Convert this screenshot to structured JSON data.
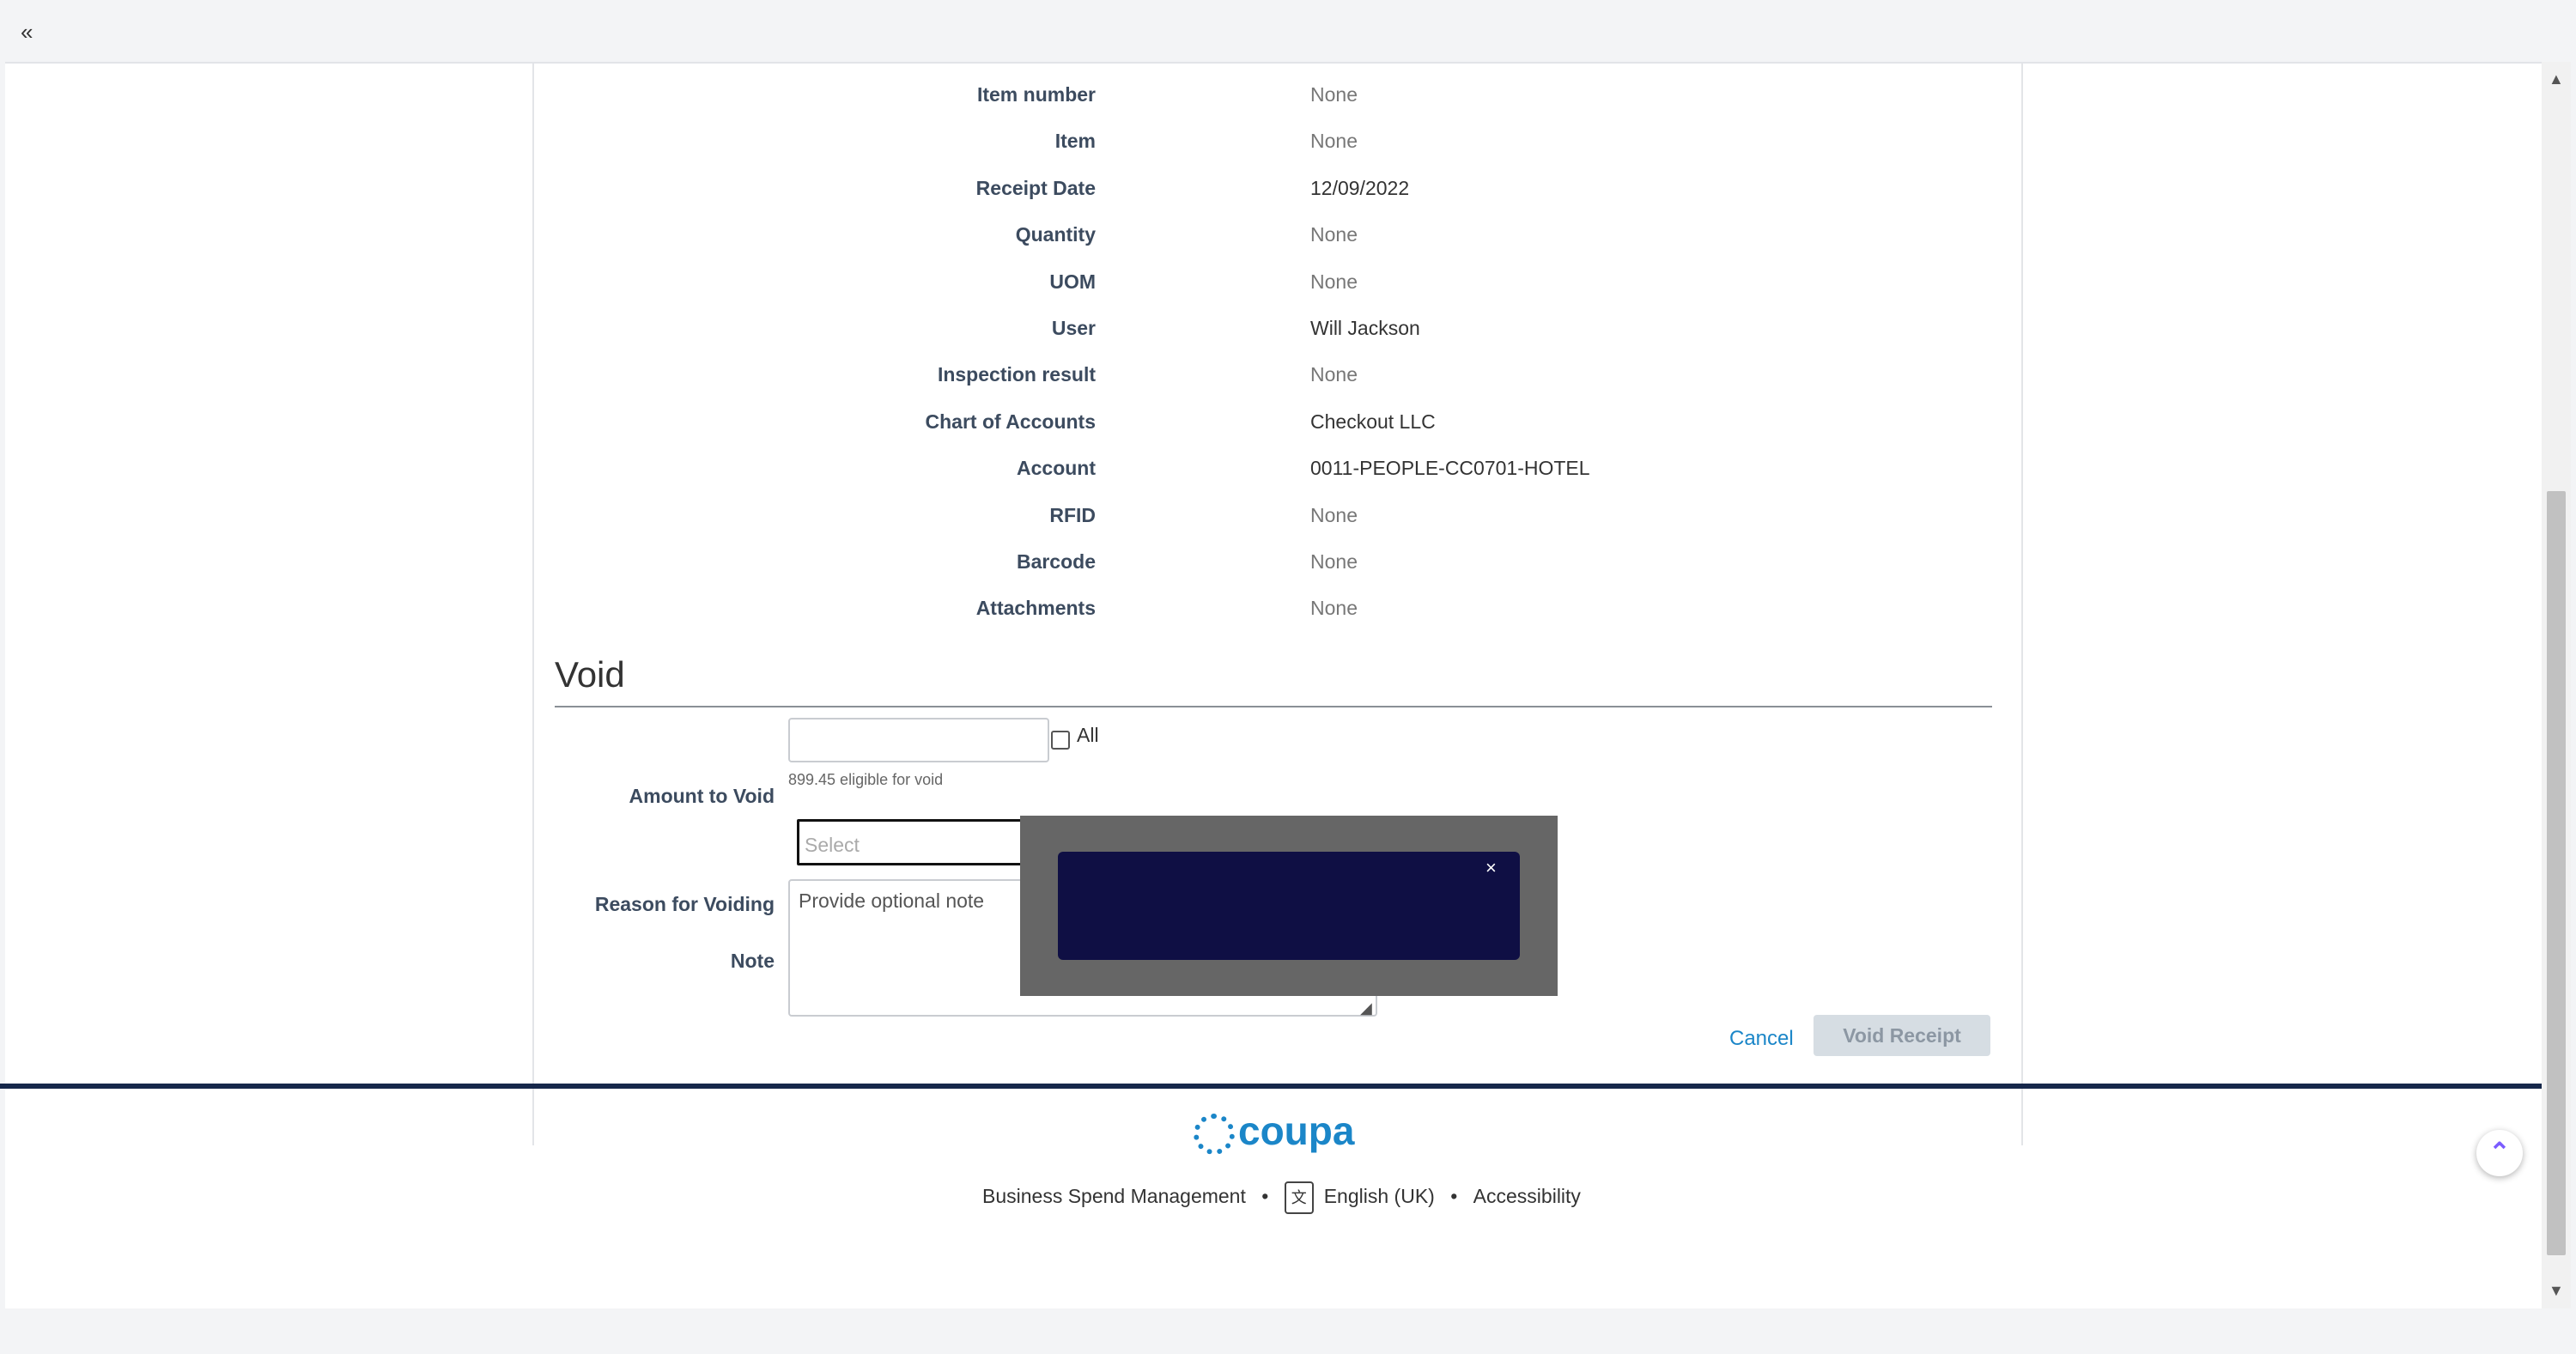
{
  "topbar": {
    "collapse_icon": "«"
  },
  "details": [
    {
      "label": "Item number",
      "value": "None",
      "muted": true
    },
    {
      "label": "Item",
      "value": "None",
      "muted": true
    },
    {
      "label": "Receipt Date",
      "value": "12/09/2022",
      "muted": false
    },
    {
      "label": "Quantity",
      "value": "None",
      "muted": true
    },
    {
      "label": "UOM",
      "value": "None",
      "muted": true
    },
    {
      "label": "User",
      "value": "Will Jackson",
      "muted": false
    },
    {
      "label": "Inspection result",
      "value": "None",
      "muted": true
    },
    {
      "label": "Chart of Accounts",
      "value": "Checkout LLC",
      "muted": false
    },
    {
      "label": "Account",
      "value": "0011-PEOPLE-CC0701-HOTEL",
      "muted": false
    },
    {
      "label": "RFID",
      "value": "None",
      "muted": true
    },
    {
      "label": "Barcode",
      "value": "None",
      "muted": true
    },
    {
      "label": "Attachments",
      "value": "None",
      "muted": true
    }
  ],
  "void": {
    "title": "Void",
    "amount_label": "Amount to Void",
    "all_label": "All",
    "eligible_text": "899.45 eligible for void",
    "reason_label": "Reason for Voiding",
    "reason_placeholder": "Select",
    "note_label": "Note",
    "note_placeholder": "Provide optional note",
    "cancel_label": "Cancel",
    "submit_label": "Void Receipt"
  },
  "footer": {
    "logo_text": "coupa",
    "tagline": "Business Spend Management",
    "separator": "•",
    "language": "English (UK)",
    "accessibility": "Accessibility"
  },
  "toast": {
    "close_glyph": "×"
  },
  "colors": {
    "link": "#1b86c8",
    "footer_line": "#16274a",
    "toast": "#0f0f44"
  }
}
